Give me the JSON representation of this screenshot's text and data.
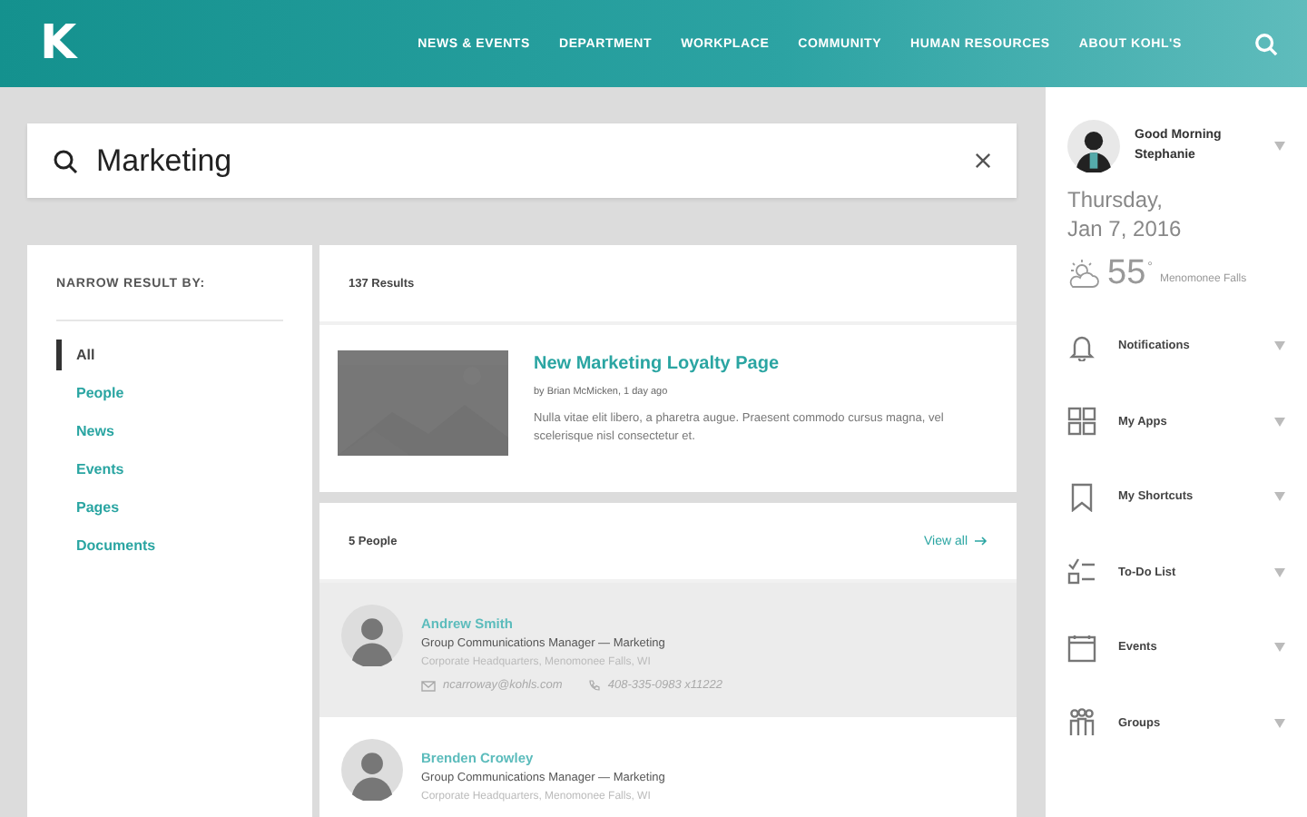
{
  "header": {
    "logo": "K",
    "nav": [
      {
        "label": "NEWS & EVENTS"
      },
      {
        "label": "DEPARTMENT"
      },
      {
        "label": "WORKPLACE"
      },
      {
        "label": "COMMUNITY"
      },
      {
        "label": "HUMAN RESOURCES"
      },
      {
        "label": "ABOUT KOHL'S"
      }
    ]
  },
  "search": {
    "value": "Marketing"
  },
  "filters": {
    "title": "NARROW RESULT BY:",
    "items": [
      {
        "label": "All",
        "selected": true
      },
      {
        "label": "People",
        "selected": false
      },
      {
        "label": "News",
        "selected": false
      },
      {
        "label": "Events",
        "selected": false
      },
      {
        "label": "Pages",
        "selected": false
      },
      {
        "label": "Documents",
        "selected": false
      }
    ]
  },
  "results": {
    "count": "137 Results",
    "article": {
      "kind": "picture",
      "title": "New Marketing Loyalty Page",
      "byline": "by Brian McMicken, 1 day ago",
      "excerpt": "Nulla vitae elit libero, a pharetra augue. Praesent commodo cursus magna, vel scelerisque nisl consectetur et."
    },
    "people": {
      "count": "5 People",
      "view_all": "View all",
      "items": [
        {
          "name": "Andrew Smith",
          "role": "Group Communications Manager — Marketing",
          "location": "Corporate Headquarters, Menomonee Falls, WI",
          "email": "ncarroway@kohls.com",
          "phone": "408-335-0983 x11222",
          "selected": true
        },
        {
          "name": "Brenden Crowley",
          "role": "Group Communications Manager — Marketing",
          "location": "Corporate Headquarters, Menomonee Falls, WI",
          "selected": false
        }
      ]
    }
  },
  "sidebar": {
    "greeting": "Good Morning",
    "user": "Stephanie",
    "day": "Thursday,",
    "date": "Jan 7, 2016",
    "temperature": "55",
    "degree": "°",
    "city": "Menomonee Falls",
    "items": [
      {
        "kind": "bell",
        "label": "Notifications"
      },
      {
        "kind": "apps",
        "label": "My Apps"
      },
      {
        "kind": "bookmark",
        "label": "My Shortcuts"
      },
      {
        "kind": "todo",
        "label": "To-Do List"
      },
      {
        "kind": "calendar",
        "label": "Events"
      },
      {
        "kind": "groups",
        "label": "Groups"
      }
    ]
  }
}
